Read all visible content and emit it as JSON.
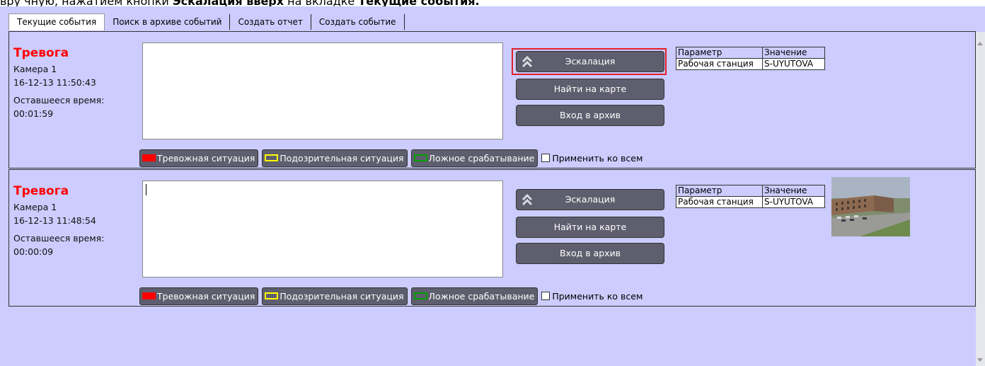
{
  "caption": {
    "prefix": "вру чную, нажатием кнопки ",
    "bold1": "Эскалация вверх",
    "middle": " на вкладке ",
    "bold2": "Текущие события."
  },
  "tabs": [
    {
      "label": "Текущие события",
      "active": true
    },
    {
      "label": "Поиск в архиве событий",
      "active": false
    },
    {
      "label": "Создать отчет",
      "active": false
    },
    {
      "label": "Создать событие",
      "active": false
    }
  ],
  "events": [
    {
      "title": "Тревога",
      "camera": "Камера 1",
      "datetime": "16-12-13 11:50:43",
      "remaining_label": "Оставшееся время:",
      "remaining": "00:01:59",
      "buttons": {
        "escalate": "Эскалация",
        "map": "Найти на карте",
        "archive": "Вход в архив"
      },
      "params": {
        "header_param": "Параметр",
        "header_value": "Значение",
        "rows": [
          {
            "param": "Рабочая станция",
            "value": "S-UYUTOVA"
          }
        ]
      },
      "marks": {
        "alarm": "Тревожная ситуация",
        "suspicious": "Подозрительная ситуация",
        "false": "Ложное срабатывание",
        "apply_all": "Применить ко всем"
      }
    },
    {
      "title": "Тревога",
      "camera": "Камера 1",
      "datetime": "16-12-13 11:48:54",
      "remaining_label": "Оставшееся время:",
      "remaining": "00:00:09",
      "buttons": {
        "escalate": "Эскалация",
        "map": "Найти на карте",
        "archive": "Вход в архив"
      },
      "params": {
        "header_param": "Параметр",
        "header_value": "Значение",
        "rows": [
          {
            "param": "Рабочая станция",
            "value": "S-UYUTOVA"
          }
        ]
      },
      "marks": {
        "alarm": "Тревожная ситуация",
        "suspicious": "Подозрительная ситуация",
        "false": "Ложное срабатывание",
        "apply_all": "Применить ко всем"
      }
    }
  ],
  "colors": {
    "background": "#ccccff",
    "alarm_title": "#ff0000",
    "button": "#5e5e6e",
    "highlight": "#e0202a"
  }
}
